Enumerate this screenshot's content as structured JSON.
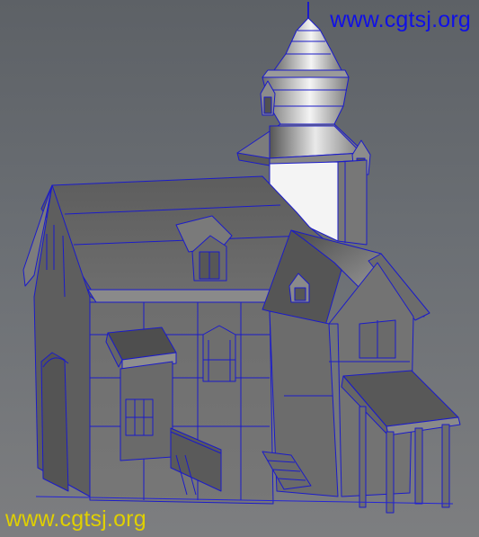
{
  "watermark_top": "www.cgtsj.org",
  "watermark_bottom": "www.cgtsj.org",
  "colors": {
    "wireframe": "#1b1bc9",
    "watermark_top": "#1010e6",
    "watermark_bottom": "#e0d000",
    "surface": "#707070",
    "sky_gradient_top": "#5d6166"
  },
  "viewport": {
    "subject": "wireframe-on-shaded house model with tower"
  }
}
